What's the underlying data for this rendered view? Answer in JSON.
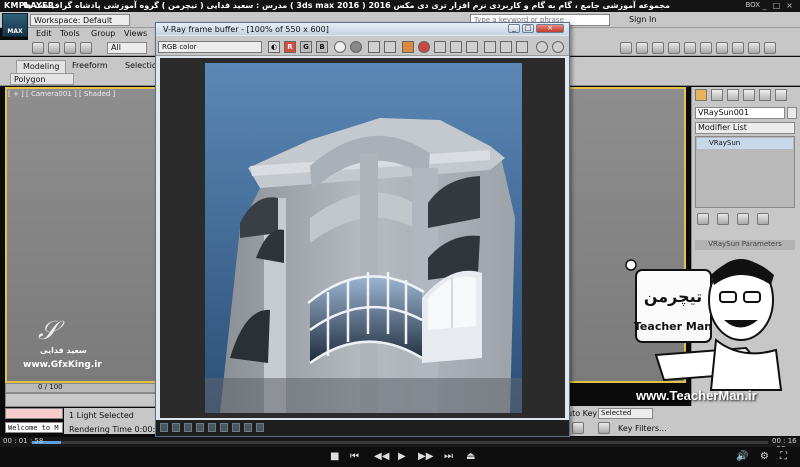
{
  "player": {
    "logo": "KMPLAYER",
    "title": "مجموعه آموزشی جامع ، گام به گام و کاربردی نرم افزار تری دی مکس 2016  ( 3ds max 2016 )  مدرس : سعید فدایی ( تیچرمن ) گروه آموزشی پادشاه گرافیست ها",
    "box_label": "BOX",
    "time_current": "00 : 01 : 58",
    "time_total": "00 : 16 : 58",
    "progress_fraction": 0.04
  },
  "max": {
    "logo_text": "MAX",
    "workspace": "Workspace: Default",
    "search_placeholder": "Type a keyword or phrase",
    "sign_in": "Sign In",
    "menus": [
      "Edit",
      "Tools",
      "Group",
      "Views"
    ],
    "selection_filter": "All",
    "ribbon_tabs": [
      "Modeling",
      "Freeform",
      "Selection"
    ],
    "ribbon_panel": "Polygon Modeling",
    "viewport_label": "[ + ] [ Camera001 ] [ Shaded ]",
    "time_slider": "0 / 100",
    "listener_text": "Welcome to M",
    "status_selected": "1 Light Selected",
    "status_rendering": "Rendering Time  0:00:22",
    "auto_key": "uto Key",
    "selected_dropdown": "Selected",
    "key_filters": "Key Filters..."
  },
  "command_panel": {
    "object_name": "VRaySun001",
    "modifier_list": "Modifier List",
    "stack_item": "VRaySun",
    "rollout_title": "VRaySun Parameters"
  },
  "vfb": {
    "title": "V-Ray frame buffer - [100% of 550 x 600]",
    "channel": "RGB color",
    "channel_buttons": [
      "R",
      "G",
      "B"
    ]
  },
  "watermark": {
    "author": "سعید فدایی",
    "site": "www.GfxKing.ir",
    "badge_site": "www.TeacherMan.ir",
    "badge_name": "Teacher Man",
    "badge_fa": "تیچرمن"
  },
  "colors": {
    "viewport_border": "#e0c24a",
    "vfb_red": "#d94c3c",
    "accent_blue": "#5aa0e0"
  }
}
